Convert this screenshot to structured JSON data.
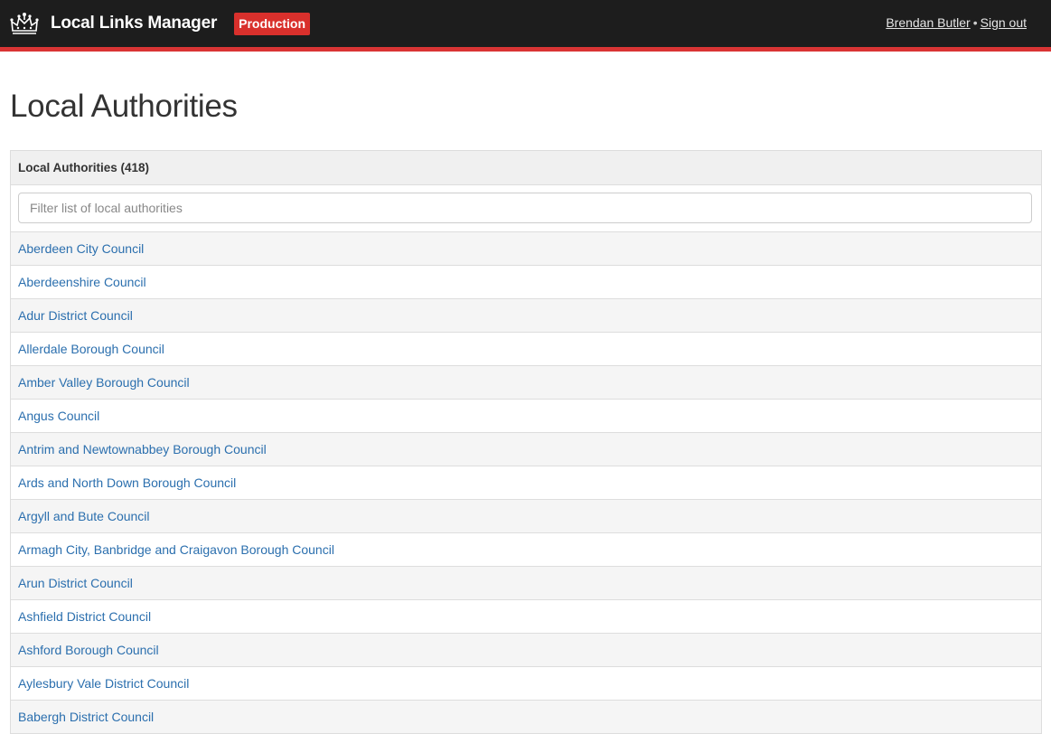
{
  "header": {
    "app_name": "Local Links Manager",
    "environment_badge": "Production",
    "user_name": "Brendan Butler",
    "separator": "•",
    "sign_out_label": "Sign out"
  },
  "page": {
    "title": "Local Authorities"
  },
  "panel": {
    "heading": "Local Authorities (418)",
    "filter_placeholder": "Filter list of local authorities",
    "authorities": [
      "Aberdeen City Council",
      "Aberdeenshire Council",
      "Adur District Council",
      "Allerdale Borough Council",
      "Amber Valley Borough Council",
      "Angus Council",
      "Antrim and Newtownabbey Borough Council",
      "Ards and North Down Borough Council",
      "Argyll and Bute Council",
      "Armagh City, Banbridge and Craigavon Borough Council",
      "Arun District Council",
      "Ashfield District Council",
      "Ashford Borough Council",
      "Aylesbury Vale District Council",
      "Babergh District Council"
    ]
  },
  "colors": {
    "navbar_bg": "#1d1d1d",
    "accent_red": "#d93434",
    "link_blue": "#2b6fae"
  },
  "icons": {
    "logo": "crown-icon"
  }
}
